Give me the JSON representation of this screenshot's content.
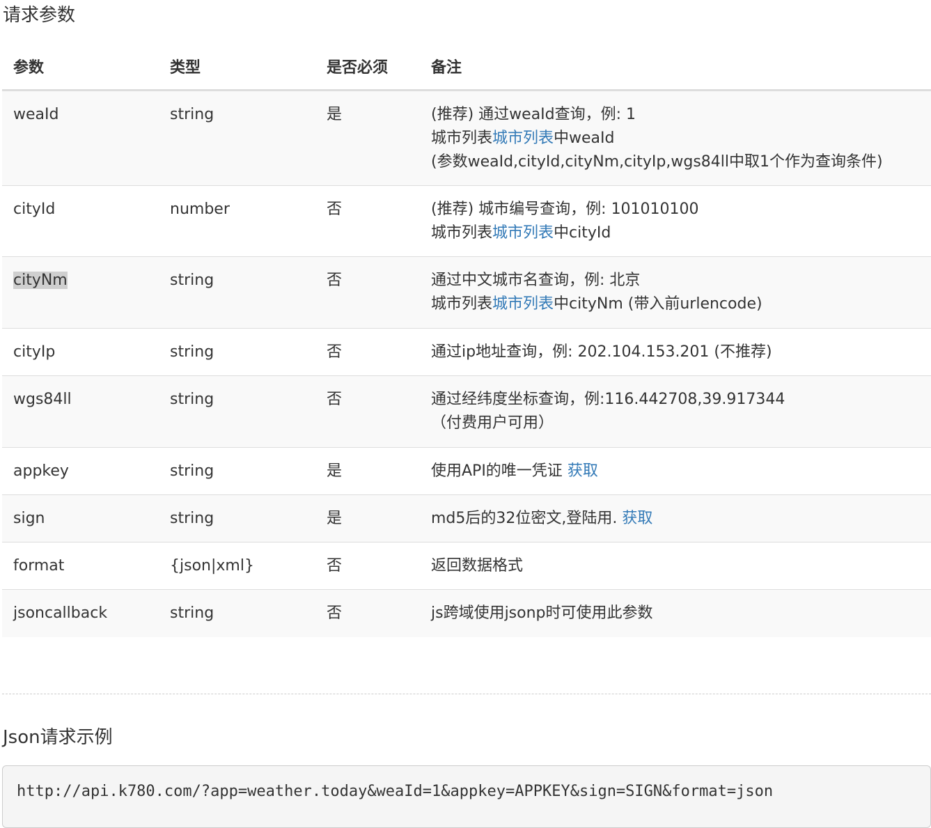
{
  "request_params": {
    "title": "请求参数",
    "headers": [
      "参数",
      "类型",
      "是否必须",
      "备注"
    ],
    "rows": [
      {
        "name": "weaId",
        "type": "string",
        "required": "是",
        "lines": [
          [
            {
              "t": "(推荐) 通过weaId查询，例: 1"
            }
          ],
          [
            {
              "t": "城市列表"
            },
            {
              "t": "城市列表",
              "link": true
            },
            {
              "t": "中weaId"
            }
          ],
          [
            {
              "t": "(参数weaId,cityId,cityNm,cityIp,wgs84ll中取1个作为查询条件)"
            }
          ]
        ]
      },
      {
        "name": "cityId",
        "type": "number",
        "required": "否",
        "lines": [
          [
            {
              "t": "(推荐) 城市编号查询，例: 101010100"
            }
          ],
          [
            {
              "t": "城市列表"
            },
            {
              "t": "城市列表",
              "link": true
            },
            {
              "t": "中cityId"
            }
          ]
        ]
      },
      {
        "name": "cityNm",
        "type": "string",
        "required": "否",
        "highlight": true,
        "lines": [
          [
            {
              "t": "通过中文城市名查询，例: 北京"
            }
          ],
          [
            {
              "t": "城市列表"
            },
            {
              "t": "城市列表",
              "link": true
            },
            {
              "t": "中cityNm (带入前urlencode)"
            }
          ]
        ]
      },
      {
        "name": "cityIp",
        "type": "string",
        "required": "否",
        "lines": [
          [
            {
              "t": "通过ip地址查询，例: 202.104.153.201 (不推荐)"
            }
          ]
        ]
      },
      {
        "name": "wgs84ll",
        "type": "string",
        "required": "否",
        "lines": [
          [
            {
              "t": "通过经纬度坐标查询，例:116.442708,39.917344"
            }
          ],
          [
            {
              "t": "（付费用户可用）"
            }
          ]
        ]
      },
      {
        "name": "appkey",
        "type": "string",
        "required": "是",
        "lines": [
          [
            {
              "t": "使用API的唯一凭证 "
            },
            {
              "t": "获取",
              "link": true
            }
          ]
        ]
      },
      {
        "name": "sign",
        "type": "string",
        "required": "是",
        "lines": [
          [
            {
              "t": "md5后的32位密文,登陆用. "
            },
            {
              "t": "获取",
              "link": true
            }
          ]
        ]
      },
      {
        "name": "format",
        "type": "{json|xml}",
        "required": "否",
        "lines": [
          [
            {
              "t": "返回数据格式"
            }
          ]
        ]
      },
      {
        "name": "jsoncallback",
        "type": "string",
        "required": "否",
        "lines": [
          [
            {
              "t": "js跨域使用jsonp时可使用此参数"
            }
          ]
        ]
      }
    ]
  },
  "json_example": {
    "title": "Json请求示例",
    "url": "http://api.k780.com/?app=weather.today&weaId=1&appkey=APPKEY&sign=SIGN&format=json"
  },
  "colors": {
    "link": "#337ab7",
    "stripe": "#f9f9f9",
    "highlight": "#cfcfcf"
  }
}
